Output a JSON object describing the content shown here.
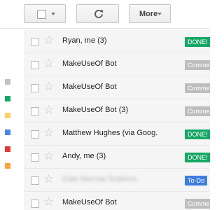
{
  "toolbar": {
    "select_icon": "checkbox-icon",
    "refresh_icon": "refresh-icon",
    "more_label": "More"
  },
  "labels_sidebar": [
    {
      "color": "#c0c0c0"
    },
    {
      "color": "#16a765"
    },
    {
      "color": "#fad165"
    },
    {
      "color": "#4a86e8"
    },
    {
      "color": "#e53935"
    },
    {
      "color": "#f9a23b"
    }
  ],
  "mail_rows": [
    {
      "sender": "Ryan, me (3)",
      "label": "DONE!",
      "label_color": "#16a765"
    },
    {
      "sender": "MakeUseOf Bot",
      "label": "Comme",
      "label_color": "#bdbdbd"
    },
    {
      "sender": "MakeUseOf Bot",
      "label": "Comme",
      "label_color": "#bdbdbd"
    },
    {
      "sender": "MakeUseOf Bot (3)",
      "label": "Comme",
      "label_color": "#bdbdbd"
    },
    {
      "sender": "Matthew Hughes (via Goog.",
      "label": "DONE!",
      "label_color": "#16a765"
    },
    {
      "sender": "Andy, me (3)",
      "label": "DONE!",
      "label_color": "#16a765"
    },
    {
      "sender": "Dale Merrow Suderns",
      "label": "To-Do",
      "label_color": "#3d7de0",
      "blurred": true
    },
    {
      "sender": "MakeUseOf Bot",
      "label": "Comme",
      "label_color": "#bdbdbd"
    }
  ]
}
